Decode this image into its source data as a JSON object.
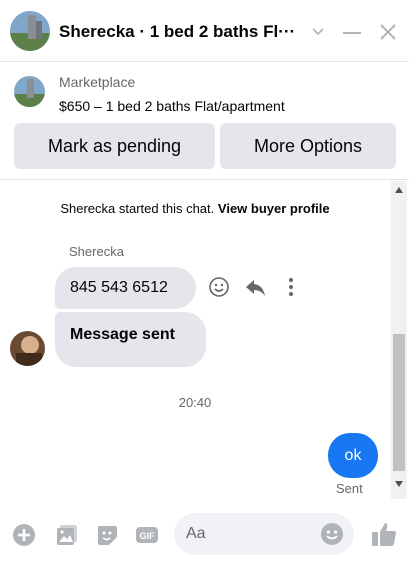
{
  "header": {
    "title": "Sherecka · 1 bed 2 baths Fl···",
    "icons": [
      "avatar-photo",
      "chevron-down-icon",
      "minimize-icon",
      "close-icon"
    ]
  },
  "listing": {
    "source": "Marketplace",
    "description": "$650 – 1 bed 2 baths Flat/apartment",
    "mark_pending_label": "Mark as pending",
    "more_options_label": "More Options"
  },
  "chat": {
    "system_prefix": "Sherecka started this chat.",
    "system_link": "View buyer profile",
    "sender_name": "Sherecka",
    "messages": [
      {
        "from": "Sherecka",
        "text": "845 543 6512"
      },
      {
        "from": "Sherecka",
        "text": "Message sent"
      }
    ],
    "timestamp": "20:40",
    "my_message": "ok",
    "my_status": "Sent"
  },
  "composer": {
    "placeholder": "Aa",
    "icons": [
      "plus-icon",
      "gallery-icon",
      "sticker-icon",
      "gif-icon",
      "emoji-icon",
      "thumbs-up-icon"
    ]
  },
  "colors": {
    "accent": "#1877f2",
    "bubble_gray": "#e4e6eb",
    "icon_gray": "#b0b3b8"
  }
}
